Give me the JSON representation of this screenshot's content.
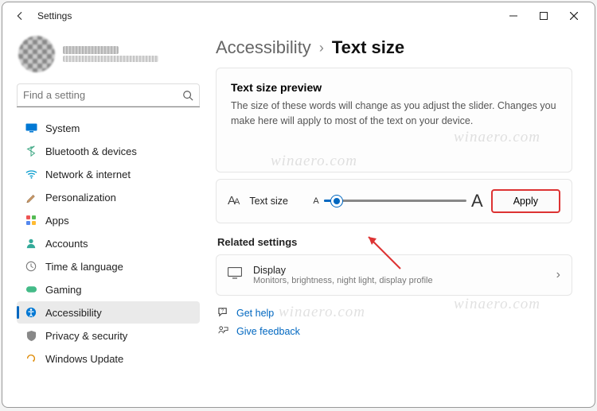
{
  "titlebar": {
    "title": "Settings"
  },
  "sidebar": {
    "search_placeholder": "Find a setting",
    "items": [
      {
        "label": "System"
      },
      {
        "label": "Bluetooth & devices"
      },
      {
        "label": "Network & internet"
      },
      {
        "label": "Personalization"
      },
      {
        "label": "Apps"
      },
      {
        "label": "Accounts"
      },
      {
        "label": "Time & language"
      },
      {
        "label": "Gaming"
      },
      {
        "label": "Accessibility"
      },
      {
        "label": "Privacy & security"
      },
      {
        "label": "Windows Update"
      }
    ]
  },
  "main": {
    "breadcrumb_parent": "Accessibility",
    "breadcrumb_current": "Text size",
    "preview_title": "Text size preview",
    "preview_body": "The size of these words will change as you adjust the slider. Changes you make here will apply to most of the text on your device.",
    "slider_label": "Text size",
    "apply_label": "Apply",
    "related_title": "Related settings",
    "display_title": "Display",
    "display_sub": "Monitors, brightness, night light, display profile",
    "help_label": "Get help",
    "feedback_label": "Give feedback"
  },
  "watermark": "winaero.com"
}
